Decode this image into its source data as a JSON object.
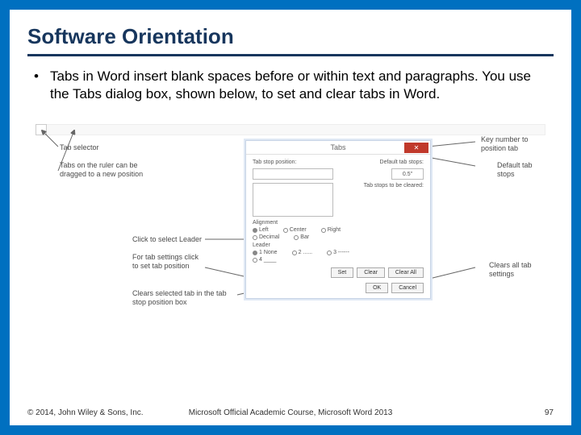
{
  "title": "Software Orientation",
  "bullet_dot": "•",
  "bullet_text": "Tabs in Word insert blank spaces before or within text and paragraphs. You use the Tabs dialog box, shown below, to set and clear tabs in Word.",
  "callouts": {
    "tab_selector": "Tab selector",
    "ruler_drag": "Tabs on the ruler can be dragged to a new position",
    "click_leader": "Click to select Leader",
    "set_tab": "For tab settings click to set tab position",
    "clear_tab": "Clears selected tab in the tab stop position box",
    "key_number": "Key number to position tab",
    "default_tab": "Default tab stops",
    "clears_all": "Clears all tab settings"
  },
  "dialog": {
    "title": "Tabs",
    "close": "✕",
    "tab_stop_label": "Tab stop position:",
    "default_label": "Default tab stops:",
    "default_value": "0.5\"",
    "cleared_text": "Tab stops to be cleared:",
    "alignment_label": "Alignment",
    "align": {
      "left": "Left",
      "center": "Center",
      "right": "Right",
      "decimal": "Decimal",
      "bar": "Bar"
    },
    "leader_label": "Leader",
    "leader": {
      "none": "1 None",
      "dots": "2 ......",
      "dashes": "3 ------",
      "under": "4 ____"
    },
    "buttons": {
      "set": "Set",
      "clear": "Clear",
      "clear_all": "Clear All",
      "ok": "OK",
      "cancel": "Cancel"
    }
  },
  "footer": {
    "left": "© 2014, John Wiley & Sons, Inc.",
    "center": "Microsoft Official Academic Course, Microsoft Word 2013",
    "right": "97"
  }
}
